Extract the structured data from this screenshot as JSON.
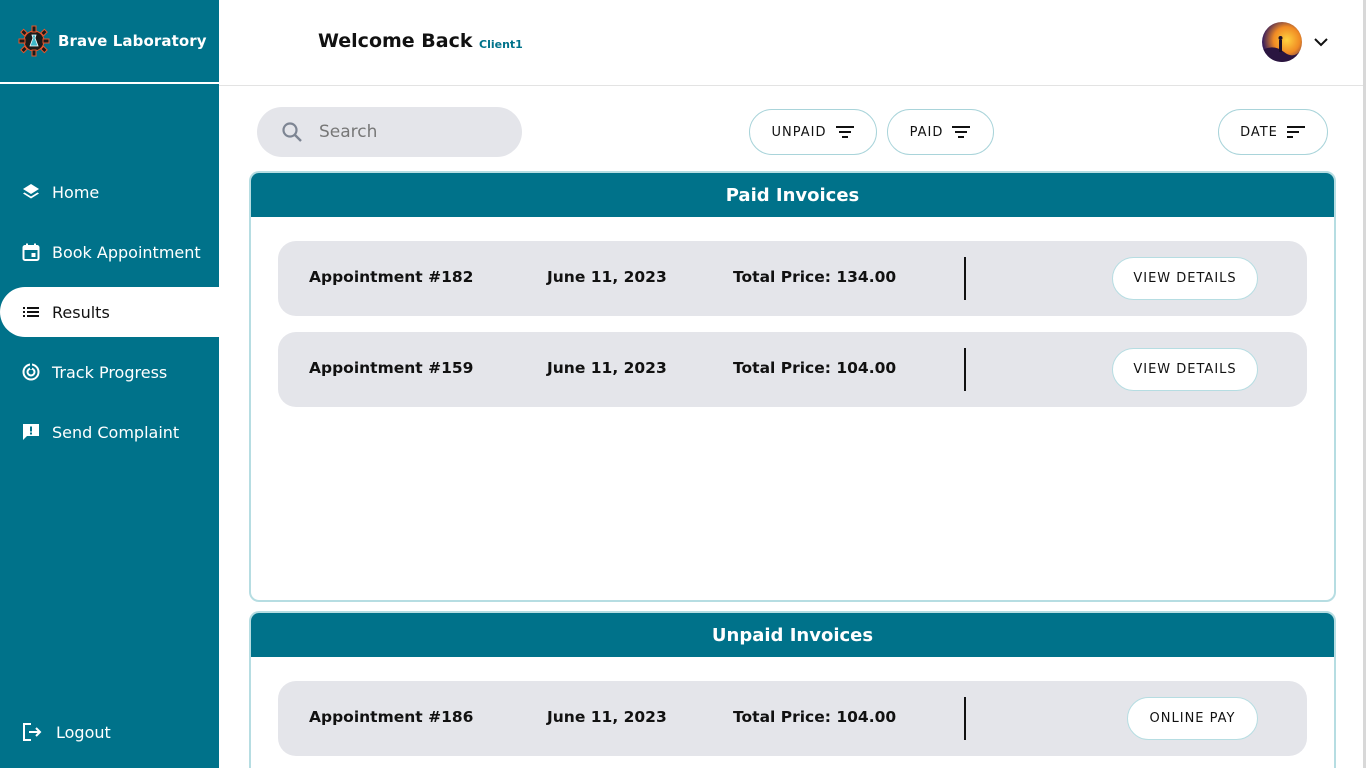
{
  "brand": {
    "name": "Brave Laboratory",
    "logo_icon": "gear-flask-icon"
  },
  "sidebar": {
    "items": [
      {
        "label": "Home",
        "icon": "layers-icon"
      },
      {
        "label": "Book Appointment",
        "icon": "calendar-icon"
      },
      {
        "label": "Results",
        "icon": "list-icon",
        "active": true
      },
      {
        "label": "Track Progress",
        "icon": "progress-icon"
      },
      {
        "label": "Send Complaint",
        "icon": "feedback-icon"
      }
    ],
    "logout_label": "Logout"
  },
  "header": {
    "welcome": "Welcome Back",
    "client": "Client1"
  },
  "toolbar": {
    "search_placeholder": "Search",
    "filters": {
      "unpaid": "UNPAID",
      "paid": "PAID",
      "date": "DATE"
    }
  },
  "paid": {
    "title": "Paid Invoices",
    "rows": [
      {
        "appointment": "Appointment #182",
        "date": "June 11, 2023",
        "total": "Total Price: 134.00",
        "action": "VIEW DETAILS"
      },
      {
        "appointment": "Appointment #159",
        "date": "June 11, 2023",
        "total": "Total Price: 104.00",
        "action": "VIEW DETAILS"
      }
    ]
  },
  "unpaid": {
    "title": "Unpaid Invoices",
    "rows": [
      {
        "appointment": "Appointment #186",
        "date": "June 11, 2023",
        "total": "Total Price: 104.00",
        "action": "ONLINE PAY"
      }
    ]
  },
  "colors": {
    "primary": "#00728a",
    "row_bg": "#e4e5ea",
    "border": "#b6dde2"
  }
}
